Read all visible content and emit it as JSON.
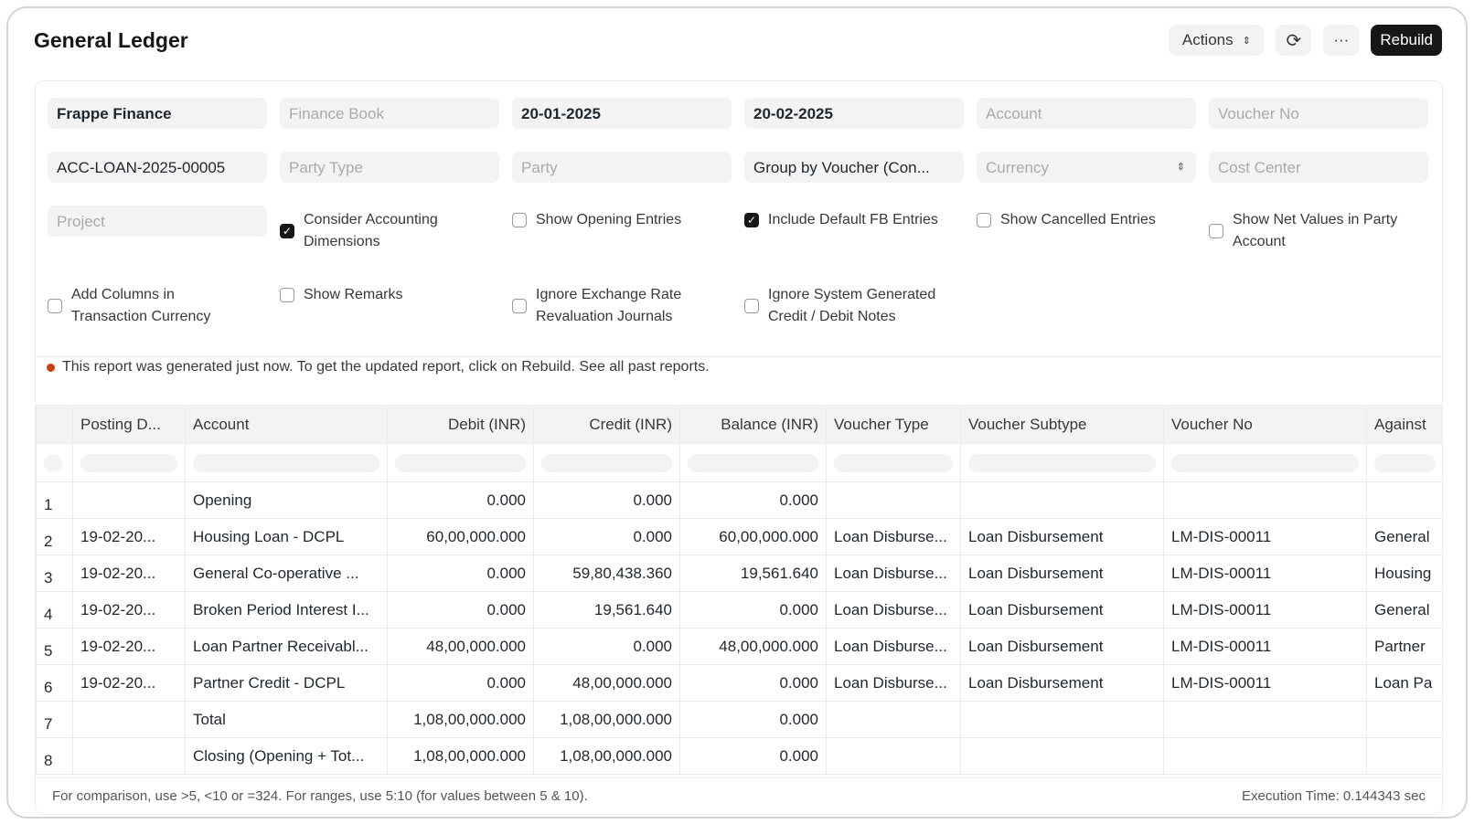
{
  "header": {
    "title": "General Ledger",
    "actions_label": "Actions",
    "refresh_icon": "refresh-icon",
    "more_label": "···",
    "rebuild_label": "Rebuild"
  },
  "filters": {
    "company": "Frappe Finance",
    "finance_book": "Finance Book",
    "from_date": "20-01-2025",
    "to_date": "20-02-2025",
    "account": "Account",
    "voucher_no": "Voucher No",
    "against_voucher": "ACC-LOAN-2025-00005",
    "party_type": "Party Type",
    "party": "Party",
    "group_by": "Group by Voucher (Con...",
    "currency": "Currency",
    "cost_center": "Cost Center",
    "project": "Project"
  },
  "checkboxes": [
    {
      "label": "Consider Accounting Dimensions",
      "checked": true
    },
    {
      "label": "Show Opening Entries",
      "checked": false
    },
    {
      "label": "Include Default FB Entries",
      "checked": true
    },
    {
      "label": "Show Cancelled Entries",
      "checked": false
    },
    {
      "label": "Show Net Values in Party Account",
      "checked": false
    },
    {
      "label": "Add Columns in Transaction Currency",
      "checked": false
    },
    {
      "label": "Show Remarks",
      "checked": false
    },
    {
      "label": "Ignore Exchange Rate Revaluation Journals",
      "checked": false
    },
    {
      "label": "Ignore System Generated Credit / Debit Notes",
      "checked": false
    }
  ],
  "message": "This report was generated just now. To get the updated report, click on Rebuild. See all past reports.",
  "table": {
    "columns": [
      "",
      "Posting D...",
      "Account",
      "Debit (INR)",
      "Credit (INR)",
      "Balance (INR)",
      "Voucher Type",
      "Voucher Subtype",
      "Voucher No",
      "Against"
    ],
    "rows": [
      [
        "1",
        "",
        "Opening",
        "0.000",
        "0.000",
        "0.000",
        "",
        "",
        "",
        ""
      ],
      [
        "2",
        "19-02-20...",
        "Housing Loan - DCPL",
        "60,00,000.000",
        "0.000",
        "60,00,000.000",
        "Loan Disburse...",
        "Loan Disbursement",
        "LM-DIS-00011",
        "General"
      ],
      [
        "3",
        "19-02-20...",
        "General Co-operative ...",
        "0.000",
        "59,80,438.360",
        "19,561.640",
        "Loan Disburse...",
        "Loan Disbursement",
        "LM-DIS-00011",
        "Housing"
      ],
      [
        "4",
        "19-02-20...",
        "Broken Period Interest I...",
        "0.000",
        "19,561.640",
        "0.000",
        "Loan Disburse...",
        "Loan Disbursement",
        "LM-DIS-00011",
        "General"
      ],
      [
        "5",
        "19-02-20...",
        "Loan Partner Receivabl...",
        "48,00,000.000",
        "0.000",
        "48,00,000.000",
        "Loan Disburse...",
        "Loan Disbursement",
        "LM-DIS-00011",
        "Partner"
      ],
      [
        "6",
        "19-02-20...",
        "Partner Credit - DCPL",
        "0.000",
        "48,00,000.000",
        "0.000",
        "Loan Disburse...",
        "Loan Disbursement",
        "LM-DIS-00011",
        "Loan Pa"
      ],
      [
        "7",
        "",
        "Total",
        "1,08,00,000.000",
        "1,08,00,000.000",
        "0.000",
        "",
        "",
        "",
        ""
      ],
      [
        "8",
        "",
        "Closing (Opening + Tot...",
        "1,08,00,000.000",
        "1,08,00,000.000",
        "0.000",
        "",
        "",
        "",
        ""
      ]
    ]
  },
  "footer": {
    "hint": "For comparison, use >5, <10 or =324. For ranges, use 5:10 (for values between 5 & 10).",
    "exec_time": "Execution Time: 0.144343 sec"
  }
}
